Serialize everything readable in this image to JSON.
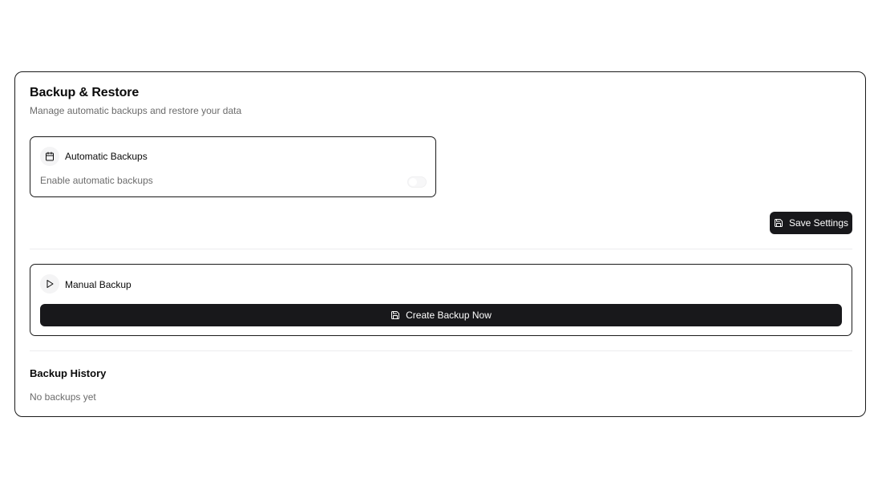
{
  "header": {
    "title": "Backup & Restore",
    "subtitle": "Manage automatic backups and restore your data"
  },
  "automatic": {
    "icon": "calendar-icon",
    "label": "Automatic Backups",
    "toggle_label": "Enable automatic backups",
    "enabled": false
  },
  "actions": {
    "save_icon": "save-icon",
    "save_label": "Save Settings"
  },
  "manual": {
    "icon": "play-icon",
    "label": "Manual Backup",
    "create_icon": "save-icon",
    "create_label": "Create Backup Now"
  },
  "history": {
    "title": "Backup History",
    "empty_text": "No backups yet"
  },
  "colors": {
    "primary_button": "#18181b",
    "border": "#1a1a1a",
    "muted_text": "#6b6b6b",
    "divider": "#ececee"
  }
}
